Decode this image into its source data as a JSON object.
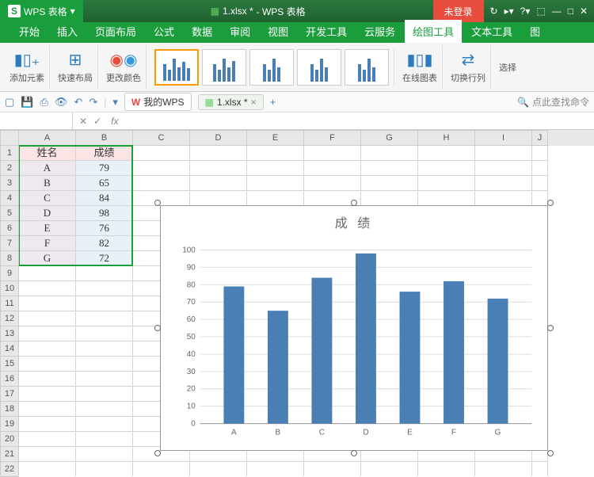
{
  "app": {
    "name": "WPS 表格",
    "filename": "1.xlsx *",
    "suffix": "- WPS 表格",
    "login": "未登录"
  },
  "ribbon_tabs": [
    "开始",
    "插入",
    "页面布局",
    "公式",
    "数据",
    "审阅",
    "视图",
    "开发工具",
    "云服务",
    "绘图工具",
    "文本工具",
    "图"
  ],
  "ribbon_active": 9,
  "ribbon_buttons": {
    "add_element": "添加元素",
    "quick_layout": "快速布局",
    "change_color": "更改颜色",
    "online_chart": "在线图表",
    "switch_rowcol": "切换行列",
    "select": "选择"
  },
  "qat": {
    "my_wps": "我的WPS",
    "doc1": "1.xlsx *"
  },
  "search": "点此查找命令",
  "columns": [
    "A",
    "B",
    "C",
    "D",
    "E",
    "F",
    "G",
    "H",
    "I",
    "J"
  ],
  "rows": 22,
  "table": {
    "header": {
      "a": "姓名",
      "b": "成绩"
    },
    "data": [
      {
        "a": "A",
        "b": "79"
      },
      {
        "a": "B",
        "b": "65"
      },
      {
        "a": "C",
        "b": "84"
      },
      {
        "a": "D",
        "b": "98"
      },
      {
        "a": "E",
        "b": "76"
      },
      {
        "a": "F",
        "b": "82"
      },
      {
        "a": "G",
        "b": "72"
      }
    ]
  },
  "chart_data": {
    "type": "bar",
    "title": "成 绩",
    "categories": [
      "A",
      "B",
      "C",
      "D",
      "E",
      "F",
      "G"
    ],
    "values": [
      79,
      65,
      84,
      98,
      76,
      82,
      72
    ],
    "ylim": [
      0,
      100
    ],
    "yticks": [
      0,
      10,
      20,
      30,
      40,
      50,
      60,
      70,
      80,
      90,
      100
    ],
    "xlabel": "",
    "ylabel": ""
  }
}
